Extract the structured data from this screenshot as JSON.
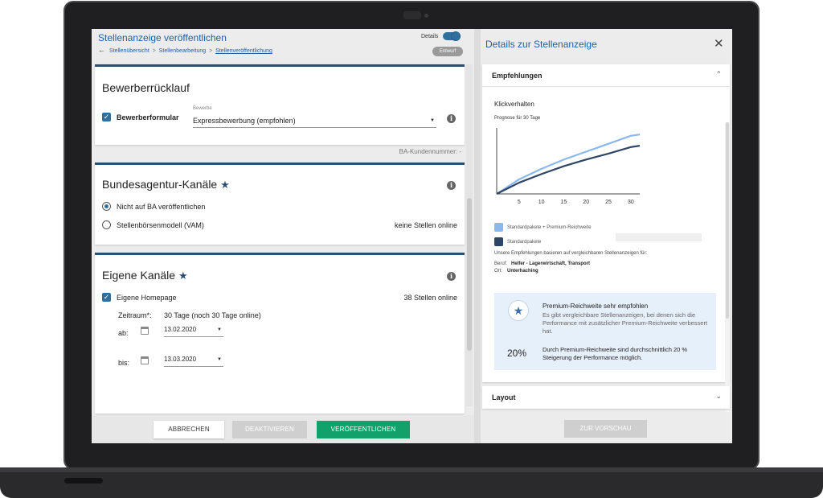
{
  "header": {
    "title": "Stellenanzeige veröffentlichen",
    "breadcrumb": [
      "Stellenübersicht",
      "Stellenbearbeitung",
      "Stellenveröffentlichung"
    ],
    "details_label": "Details",
    "status_badge": "Entwurf"
  },
  "applicant_section": {
    "title": "Bewerberrücklauf",
    "form_checkbox_label": "Bewerberformular",
    "select_label": "Bewerbe",
    "select_value": "Expressbewerbung (empfohlen)"
  },
  "ba_customer_number": "BA-Kundennummer: -",
  "ba_channels": {
    "title": "Bundesagentur-Kanäle",
    "options": [
      "Nicht auf BA veröffentlichen",
      "Stellenbörsenmodell (VAM)"
    ],
    "vam_status": "keine Stellen online"
  },
  "own_channels": {
    "title": "Eigene Kanäle",
    "homepage_label": "Eigene Homepage",
    "homepage_status": "38 Stellen online",
    "period_label": "Zeitraum*:",
    "period_value": "30 Tage (noch 30 Tage online)",
    "from_label": "ab:",
    "from_date": "13.02.2020",
    "to_label": "bis:",
    "to_date": "13.03.2020"
  },
  "footer": {
    "cancel": "ABBRECHEN",
    "deactivate": "DEAKTIVIEREN",
    "publish": "VERÖFFENTLICHEN"
  },
  "details_panel": {
    "title": "Details zur Stellenanzeige",
    "recommendations_header": "Empfehlungen",
    "click_behavior": "Klickverhalten",
    "forecast_label": "Prognose für 30 Tage",
    "legend": [
      "Standardpakete + Premium-Reichweite",
      "Standardpakete"
    ],
    "basis_text": "Unsere Empfehlungen basieren auf vergleichbaren Stellenanzeigen für:",
    "job_label": "Beruf:",
    "job_value": "Helfer - Lagerwirtschaft, Transport",
    "location_label": "Ort:",
    "location_value": "Unterhaching",
    "tip_title": "Premium-Reichweite sehr empfohlen",
    "tip_text": "Es gibt vergleichbare Stellenanzeigen, bei denen sich die Performance mit zusätzlicher Premium-Reichweite verbessert hat.",
    "tip_percent": "20%",
    "tip_percent_text": "Durch Premium-Reichweite sind durchschnittlich 20 % Steigerung der Performance möglich.",
    "layout_header": "Layout",
    "preview_button": "ZUR VORSCHAU"
  },
  "colors": {
    "accent": "#1f5fa5",
    "premium_series": "#8ab8ec",
    "standard_series": "#2e4566",
    "publish": "#12a06b"
  },
  "chart_data": {
    "type": "line",
    "title": "Prognose für 30 Tage",
    "x_ticks": [
      5,
      10,
      15,
      20,
      25,
      30
    ],
    "xlim": [
      0,
      32
    ],
    "ylim": [
      0,
      100
    ],
    "series": [
      {
        "name": "Standardpakete + Premium-Reichweite",
        "x": [
          0,
          5,
          10,
          15,
          20,
          25,
          30,
          32
        ],
        "y": [
          0,
          22,
          38,
          52,
          64,
          76,
          88,
          90
        ]
      },
      {
        "name": "Standardpakete",
        "x": [
          0,
          5,
          10,
          15,
          20,
          25,
          30,
          32
        ],
        "y": [
          0,
          17,
          30,
          42,
          52,
          61,
          71,
          73
        ]
      }
    ]
  }
}
